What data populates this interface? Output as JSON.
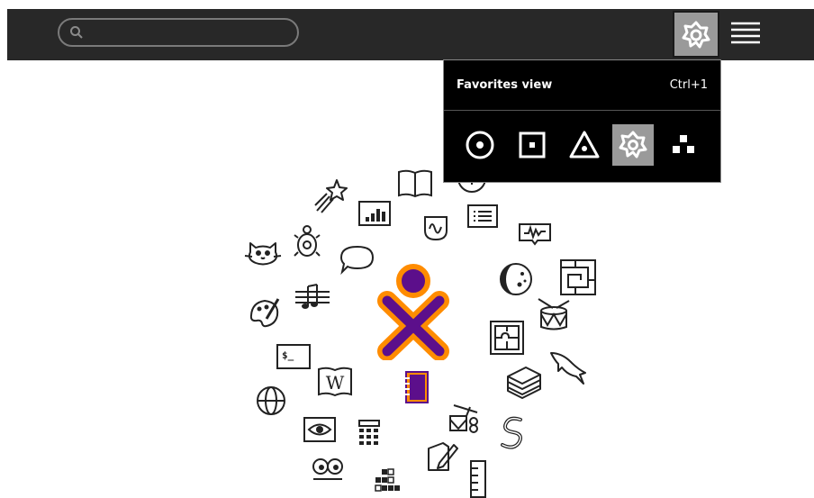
{
  "search": {
    "placeholder": ""
  },
  "palette": {
    "title": "Favorites view",
    "accelerator": "Ctrl+1",
    "views": [
      "Favorites view",
      "Home view",
      "Neighborhood view",
      "Group view",
      "List view"
    ]
  },
  "colors": {
    "toolbar": "#282828",
    "accent_gray": "#9a9a9a",
    "xo_stroke": "#ff8c00",
    "xo_fill": "#5c0f8b"
  },
  "activities": [
    "star-activity-icon",
    "book-activity-icon",
    "chart-activity-icon",
    "measure-activity-icon",
    "list-activity-icon",
    "oscilloscope-activity-icon",
    "turtle-activity-icon",
    "cat-activity-icon",
    "chat-activity-icon",
    "moon-activity-icon",
    "maze-activity-icon",
    "paint-activity-icon",
    "music-activity-icon",
    "drum-activity-icon",
    "puzzle-activity-icon",
    "terminal-activity-icon",
    "dolphin-activity-icon",
    "wikipedia-activity-icon",
    "journal-activity-icon",
    "stack-activity-icon",
    "browse-activity-icon",
    "speak-eye-activity-icon",
    "calculator-activity-icon",
    "music-toys-activity-icon",
    "snake-activity-icon",
    "write-activity-icon",
    "eyes-activity-icon",
    "blocks-activity-icon",
    "ruler-activity-icon"
  ]
}
